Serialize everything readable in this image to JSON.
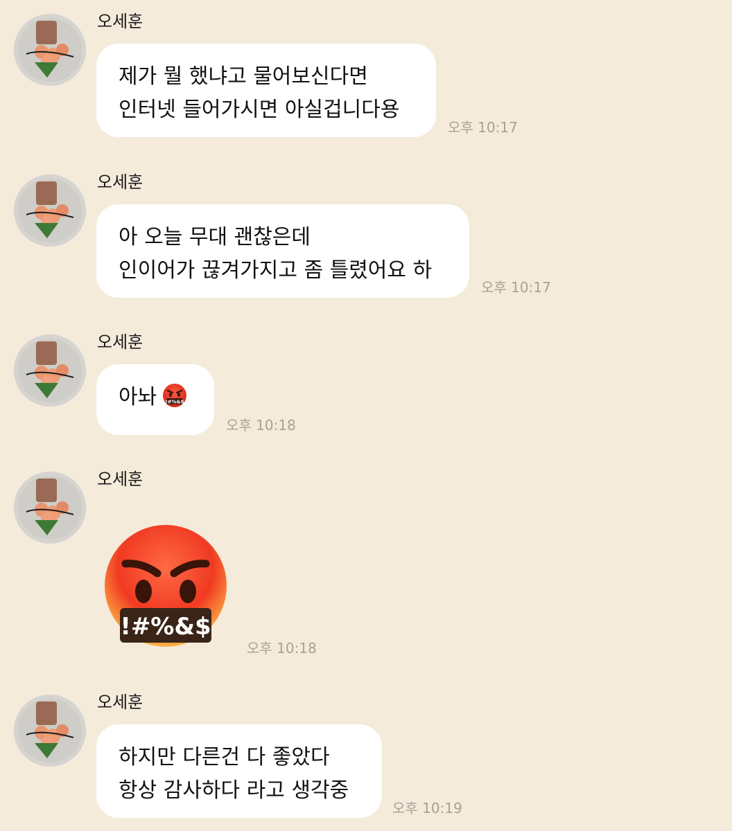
{
  "messages": [
    {
      "sender": "오세훈",
      "lines": [
        "제가 뭘 했냐고 물어보신다면",
        "인터넷 들어가시면 아실겁니다용"
      ],
      "time": "오후 10:17"
    },
    {
      "sender": "오세훈",
      "lines": [
        "아 오늘 무대 괜찮은데",
        "인이어가 끊겨가지고 좀 틀렸어요 하"
      ],
      "time": "오후 10:17"
    },
    {
      "sender": "오세훈",
      "lines": [
        "아놔"
      ],
      "emoji": "face-with-symbols-on-mouth",
      "time": "오후 10:18"
    },
    {
      "sender": "오세훈",
      "big_emoji": "face-with-symbols-on-mouth",
      "emoji_text": "!#%&$",
      "time": "오후 10:18"
    },
    {
      "sender": "오세훈",
      "lines": [
        "하지만 다른건 다 좋았다",
        "항상 감사하다 라고 생각중"
      ],
      "time": "오후 10:19"
    }
  ],
  "colors": {
    "background": "#f4ebdb",
    "bubble": "#ffffff",
    "timestamp": "#a8a196"
  }
}
